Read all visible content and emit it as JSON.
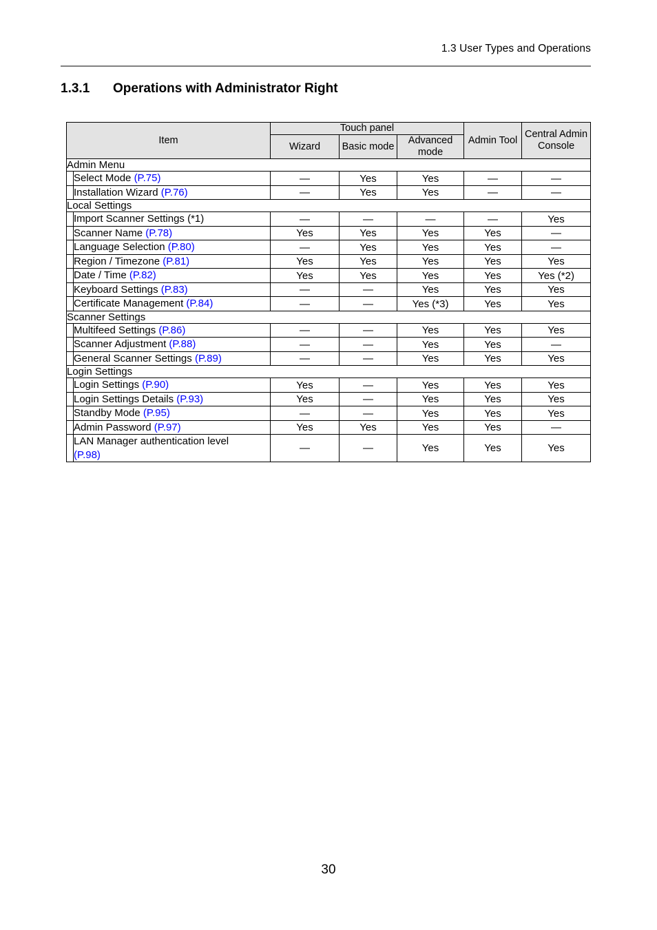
{
  "document": {
    "running_header": "1.3 User Types and Operations",
    "section_number": "1.3.1",
    "section_title": "Operations with Administrator Right",
    "page_number": "30",
    "link_color": "#0000FF",
    "header_rule_color": "#808080",
    "table_header_bg": "#E3E3E3"
  },
  "table": {
    "header": {
      "item_label": "Item",
      "group_label": "Touch panel",
      "touch_panel_columns": [
        "Wizard",
        "Basic mode",
        "Advanced mode"
      ],
      "admin_tool_label": "Admin Tool",
      "central_admin_console_label": "Central Admin Console"
    },
    "yes": "Yes",
    "no": "—",
    "sections": [
      {
        "name": "Admin Menu",
        "rows": [
          {
            "item": "Select Mode",
            "ref": "(P.75)",
            "values": [
              "—",
              "Yes",
              "Yes",
              "—",
              "—"
            ]
          },
          {
            "item": "Installation Wizard",
            "ref": "(P.76)",
            "values": [
              "—",
              "Yes",
              "Yes",
              "—",
              "—"
            ]
          }
        ]
      },
      {
        "name": "Local Settings",
        "rows": [
          {
            "item": "Import Scanner Settings (*1)",
            "ref": "",
            "values": [
              "—",
              "—",
              "—",
              "—",
              "Yes"
            ]
          },
          {
            "item": "Scanner Name",
            "ref": "(P.78)",
            "values": [
              "Yes",
              "Yes",
              "Yes",
              "Yes",
              "—"
            ]
          },
          {
            "item": "Language Selection",
            "ref": "(P.80)",
            "values": [
              "—",
              "Yes",
              "Yes",
              "Yes",
              "—"
            ]
          },
          {
            "item": "Region / Timezone",
            "ref": "(P.81)",
            "values": [
              "Yes",
              "Yes",
              "Yes",
              "Yes",
              "Yes"
            ]
          },
          {
            "item": "Date / Time",
            "ref": "(P.82)",
            "values": [
              "Yes",
              "Yes",
              "Yes",
              "Yes",
              "Yes (*2)"
            ]
          },
          {
            "item": "Keyboard Settings",
            "ref": "(P.83)",
            "values": [
              "—",
              "—",
              "Yes",
              "Yes",
              "Yes"
            ]
          },
          {
            "item": "Certificate Management",
            "ref": "(P.84)",
            "values": [
              "—",
              "—",
              "Yes (*3)",
              "Yes",
              "Yes"
            ]
          }
        ]
      },
      {
        "name": "Scanner Settings",
        "rows": [
          {
            "item": "Multifeed Settings",
            "ref": "(P.86)",
            "values": [
              "—",
              "—",
              "Yes",
              "Yes",
              "Yes"
            ]
          },
          {
            "item": "Scanner Adjustment",
            "ref": "(P.88)",
            "values": [
              "—",
              "—",
              "Yes",
              "Yes",
              "—"
            ]
          },
          {
            "item": "General Scanner Settings",
            "ref": "(P.89)",
            "values": [
              "—",
              "—",
              "Yes",
              "Yes",
              "Yes"
            ]
          }
        ]
      },
      {
        "name": "Login Settings",
        "rows": [
          {
            "item": "Login Settings",
            "ref": "(P.90)",
            "values": [
              "Yes",
              "—",
              "Yes",
              "Yes",
              "Yes"
            ]
          },
          {
            "item": "Login Settings Details",
            "ref": "(P.93)",
            "values": [
              "Yes",
              "—",
              "Yes",
              "Yes",
              "Yes"
            ]
          },
          {
            "item": "Standby Mode",
            "ref": "(P.95)",
            "values": [
              "—",
              "—",
              "Yes",
              "Yes",
              "Yes"
            ]
          },
          {
            "item": "Admin Password",
            "ref": "(P.97)",
            "values": [
              "Yes",
              "Yes",
              "Yes",
              "Yes",
              "—"
            ]
          },
          {
            "item": "LAN Manager authentication level",
            "ref": "(P.98)",
            "ref_on_new_line": true,
            "values": [
              "—",
              "—",
              "Yes",
              "Yes",
              "Yes"
            ]
          }
        ]
      }
    ]
  }
}
